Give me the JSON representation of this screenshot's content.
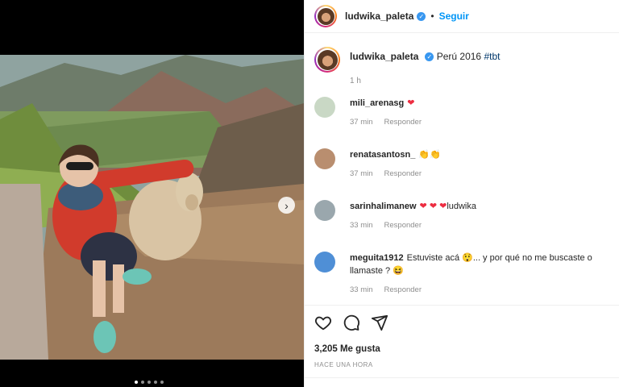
{
  "post": {
    "username": "ludwika_paleta",
    "separator": "•",
    "follow_label": "Seguir",
    "verified_glyph": "✓",
    "caption_text": "Perú 2016",
    "caption_hashtag": "#tbt",
    "caption_time": "1 h",
    "likes": "3,205 Me gusta",
    "posted_ago": "HACE UNA HORA",
    "carousel": {
      "count": 5,
      "active_index": 1
    }
  },
  "comments": [
    {
      "user": "mili_arenasg",
      "text": "",
      "emoji": "❤",
      "time": "37 min",
      "reply": "Responder",
      "avatar_color": "#c9d8c5"
    },
    {
      "user": "renatasantosn_",
      "text": "",
      "emoji": "👏👏",
      "time": "37 min",
      "reply": "Responder",
      "avatar_color": "#b98e6f"
    },
    {
      "user": "sarinhalimanew",
      "text": "ludwika",
      "emoji": "❤ ❤ ❤",
      "time": "33 min",
      "reply": "Responder",
      "avatar_color": "#9aa7ad"
    },
    {
      "user": "meguita1912",
      "text": "Estuviste acá 😲... y por qué no me buscaste o llamaste ? 😆",
      "emoji": "",
      "time": "33 min",
      "reply": "Responder",
      "avatar_color": "#4f8fd6"
    }
  ],
  "icons": {
    "like": "heart-outline-icon",
    "comment": "speech-bubble-icon",
    "share": "paper-plane-icon",
    "next": "chevron-right-icon"
  },
  "colors": {
    "follow": "#0095f6",
    "verified": "#3897f0",
    "hashtag": "#00376b",
    "meta": "#8e8e8e"
  }
}
